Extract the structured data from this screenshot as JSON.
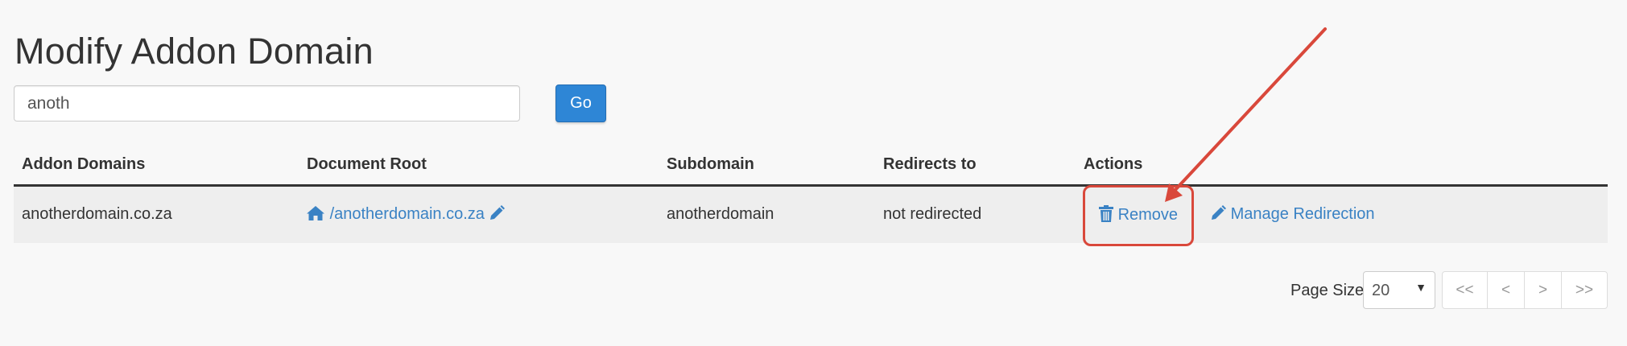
{
  "page": {
    "title": "Modify Addon Domain"
  },
  "search": {
    "value": "anoth",
    "go_label": "Go"
  },
  "table": {
    "headers": [
      "Addon Domains",
      "Document Root",
      "Subdomain",
      "Redirects to",
      "Actions"
    ],
    "rows": [
      {
        "addon_domain": "anotherdomain.co.za",
        "document_root": "/anotherdomain.co.za",
        "subdomain": "anotherdomain",
        "redirects_to": "not redirected",
        "actions": {
          "remove": "Remove",
          "manage_redirection": "Manage Redirection"
        }
      }
    ]
  },
  "pagination": {
    "page_size_label": "Page Size",
    "page_size": "20",
    "buttons": [
      "<<",
      "<",
      ">",
      ">>"
    ]
  },
  "icons": {
    "home": "home-icon",
    "edit": "pencil-icon",
    "remove": "trash-icon",
    "manage": "pencil-icon"
  },
  "colors": {
    "accent": "#2e86d6",
    "link": "#3a82c4",
    "annotation": "#d9483b"
  }
}
